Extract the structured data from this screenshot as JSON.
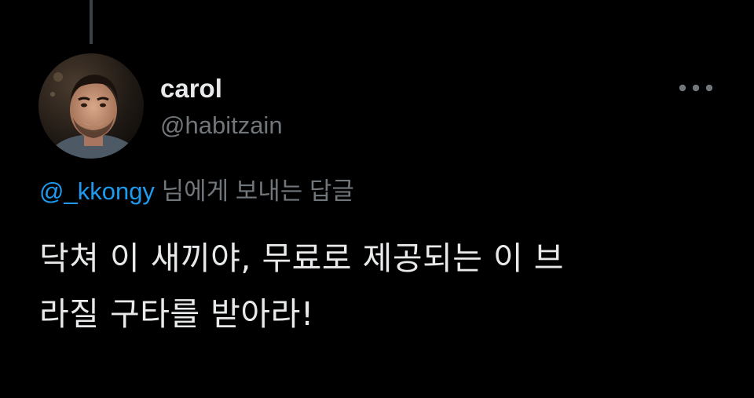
{
  "tweet": {
    "display_name": "carol",
    "handle": "@habitzain",
    "reply_to": {
      "mention": "@_kkongy",
      "suffix": "님에게 보내는 답글"
    },
    "text_lines": [
      "닥쳐 이 새끼야, 무료로 제공되는 이 브",
      "라질 구타를 받아라!"
    ]
  },
  "icons": {
    "more": "more-horizontal-icon",
    "avatar": "profile-avatar"
  },
  "colors": {
    "background": "#000000",
    "primary_text": "#e7e9ea",
    "secondary_text": "#71767b",
    "link": "#1d9bf0"
  }
}
